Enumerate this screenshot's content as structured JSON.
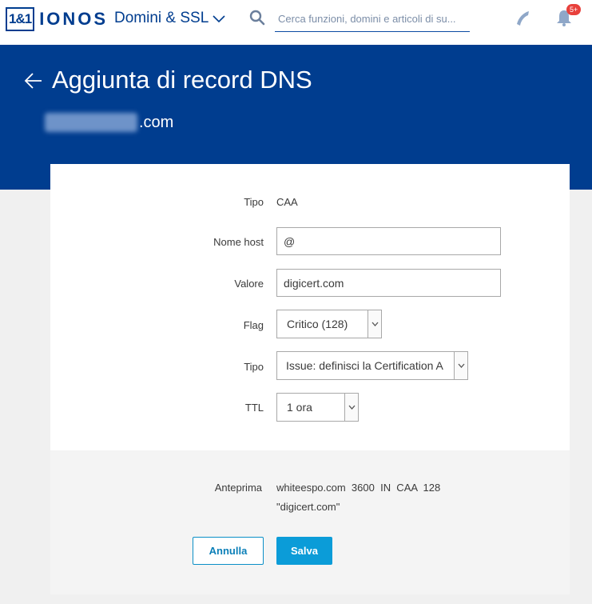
{
  "topbar": {
    "logo_box": "1&1",
    "logo_text": "IONOS",
    "product": "Domini & SSL",
    "search_placeholder": "Cerca funzioni, domini e articoli di su...",
    "notification_badge": "5+"
  },
  "header": {
    "title": "Aggiunta di record DNS",
    "domain_suffix": ".com"
  },
  "form": {
    "tipo_label": "Tipo",
    "tipo_value": "CAA",
    "host_label": "Nome host",
    "host_value": "@",
    "valore_label": "Valore",
    "valore_value": "digicert.com",
    "flag_label": "Flag",
    "flag_value": "Critico (128)",
    "tag_label": "Tipo",
    "tag_value": "Issue: definisci la Certification A",
    "ttl_label": "TTL",
    "ttl_value": "1 ora"
  },
  "preview": {
    "label": "Anteprima",
    "line1": "whiteespo.com  3600  IN  CAA  128",
    "line2": "\"digicert.com\""
  },
  "actions": {
    "cancel": "Annulla",
    "save": "Salva"
  },
  "colors": {
    "brand": "#003d8f",
    "accent": "#0b9cd8",
    "badge": "#e8413c"
  }
}
